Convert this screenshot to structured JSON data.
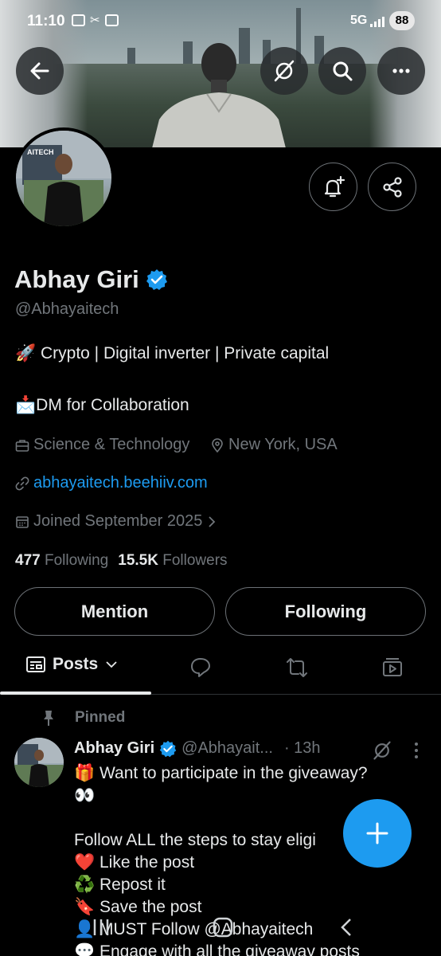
{
  "status_bar": {
    "time": "11:10",
    "network": "5G",
    "battery": "88"
  },
  "profile": {
    "name": "Abhay Giri",
    "handle": "@Abhayaitech",
    "bio_line1": "🚀 Crypto  | Digital inverter |  Private capital",
    "bio_line2": "📩DM for Collaboration",
    "category": "Science & Technology",
    "location": "New York, USA",
    "website": "abhayaitech.beehiiv.com",
    "joined": "Joined September 2025",
    "following_count": "477",
    "following_label": "Following",
    "followers_count": "15.5K",
    "followers_label": "Followers",
    "avatar_logo_text": "AITECH"
  },
  "actions": {
    "mention_label": "Mention",
    "following_label": "Following"
  },
  "tabs": {
    "active_label": "Posts"
  },
  "post": {
    "pinned_label": "Pinned",
    "author_name": "Abhay Giri",
    "author_handle": "@Abhayait...",
    "time": "· 13h",
    "lines": [
      "🎁 Want to participate in the giveaway?",
      "👀",
      "",
      "Follow ALL the steps to stay eligi",
      "❤️ Like the post",
      "♻️ Repost it",
      "🔖 Save the post",
      "👤 MUST Follow @Abhayaitech",
      "💬 Engage with all the giveaway posts"
    ]
  },
  "colors": {
    "accent": "#1d9bf0",
    "background": "#000000",
    "muted": "#71767b",
    "text": "#e7e9ea"
  },
  "icons": [
    "back-arrow-icon",
    "grok-icon",
    "search-icon",
    "more-icon",
    "bell-plus-icon",
    "share-icon",
    "verified-icon",
    "briefcase-icon",
    "location-icon",
    "link-icon",
    "calendar-icon",
    "chevron-right-icon",
    "posts-icon",
    "chevron-down-icon",
    "replies-icon",
    "repost-icon",
    "media-icon",
    "pin-icon",
    "plus-icon"
  ]
}
